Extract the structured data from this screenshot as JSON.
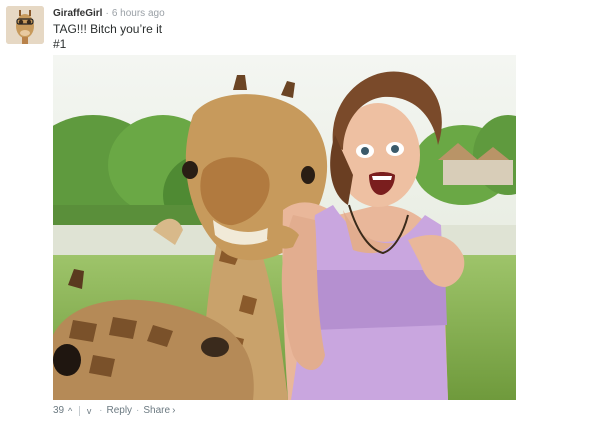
{
  "comment": {
    "author": "GiraffeGirl",
    "separator": "·",
    "timestamp": "6 hours ago",
    "lines": [
      "TAG!!! Bitch you’re it",
      "#1"
    ],
    "photo_icon": "photo-giraffe-woman"
  },
  "footer": {
    "votes": "39",
    "upvote_icon": "^",
    "downvote_icon": "v",
    "dot": "·",
    "reply_label": "Reply",
    "share_label": "Share",
    "share_chevron": "›"
  },
  "colors": {
    "author": "#333333",
    "meta": "#9aa0a6",
    "footer": "#6c7a82"
  }
}
